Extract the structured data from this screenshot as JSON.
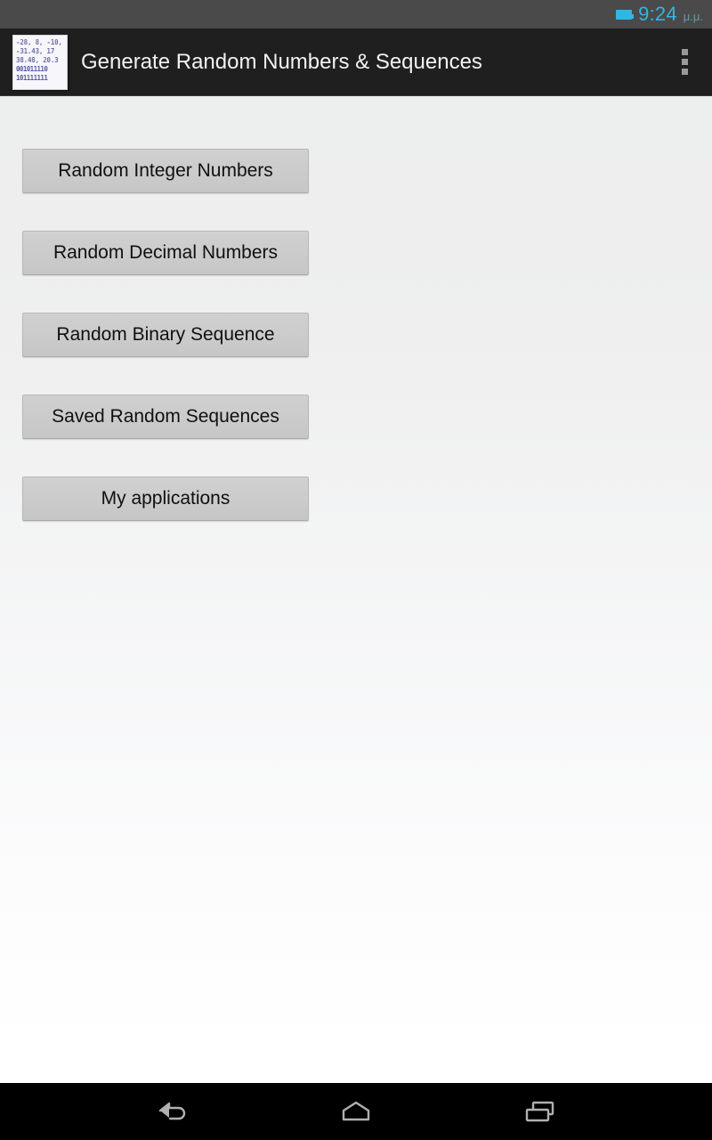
{
  "status_bar": {
    "battery_icon": "battery-icon",
    "time": "9:24",
    "ampm": "μ.μ."
  },
  "action_bar": {
    "app_icon": "app-logo-icon",
    "icon_lines": [
      "-28, 8, -10,",
      "-31.43, 17",
      "38.48, 20.3",
      "001011110",
      "101111111"
    ],
    "title": "Generate Random Numbers & Sequences",
    "overflow_label": "overflow-menu-icon"
  },
  "main": {
    "buttons": [
      {
        "id": "random-integer-numbers",
        "label": "Random Integer Numbers"
      },
      {
        "id": "random-decimal-numbers",
        "label": "Random Decimal Numbers"
      },
      {
        "id": "random-binary-sequence",
        "label": "Random Binary Sequence"
      },
      {
        "id": "saved-random-sequences",
        "label": "Saved Random Sequences"
      },
      {
        "id": "my-applications",
        "label": "My applications"
      }
    ]
  },
  "nav_bar": {
    "back": "back-icon",
    "home": "home-icon",
    "recents": "recents-icon"
  },
  "colors": {
    "status_bar_bg": "#4a4a4a",
    "action_bar_bg": "#1f1f1f",
    "accent_cyan": "#33b5e5",
    "button_fill": "#cbcbcb",
    "nav_bar_bg": "#000000"
  }
}
